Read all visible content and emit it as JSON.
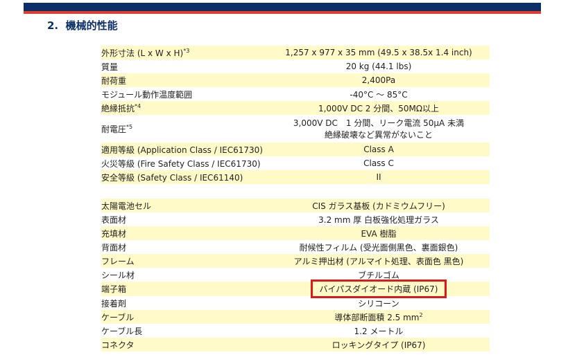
{
  "section": {
    "number": "2.",
    "title": "機械的性能"
  },
  "table1": [
    {
      "label": "外形寸法 (L x W x H)",
      "sup": "*3",
      "value": "1,257 x 977 x 35 mm (49.5 x 38.5x 1.4 inch)"
    },
    {
      "label": "質量",
      "value": "20 kg (44.1 lbs)"
    },
    {
      "label": "耐荷重",
      "value": "2,400Pa"
    },
    {
      "label": "モジュール動作温度範囲",
      "value": "-40°C ～ 85°C"
    },
    {
      "label": "絶縁抵抗",
      "sup": "*4",
      "value": "1,000V DC 2 分間、50MΩ以上"
    },
    {
      "label": "耐電圧",
      "sup": "*5",
      "value": "3,000V DC　1 分間、リーク電流 50μA 未満",
      "value2": "絶縁破壊など異常がないこと"
    },
    {
      "label": "適用等級 (Application Class / IEC61730)",
      "value": "Class A"
    },
    {
      "label": "火災等級 (Fire Safety Class / IEC61730)",
      "value": "Class C"
    },
    {
      "label": "安全等級 (Safety Class / IEC61140)",
      "value": "II"
    }
  ],
  "table2": [
    {
      "label": "太陽電池セル",
      "value": "CIS ガラス基板 (カドミウムフリー)"
    },
    {
      "label": "表面材",
      "value": "3.2 mm 厚 白板強化処理ガラス"
    },
    {
      "label": "充填材",
      "value": "EVA 樹脂"
    },
    {
      "label": "背面材",
      "value": "耐候性フィルム (受光面側黒色、裏面銀色)"
    },
    {
      "label": "フレーム",
      "value": "アルミ押出材 (アルマイト処理、表面色 黒色)"
    },
    {
      "label": "シール材",
      "value": "ブチルゴム"
    },
    {
      "label": "端子箱",
      "value": "バイパスダイオード内蔵 (IP67)"
    },
    {
      "label": "接着剤",
      "value": "シリコーン"
    },
    {
      "label": "ケーブル",
      "value": "導体部断面積 2.5 mm",
      "sup": "2"
    },
    {
      "label": "ケーブル長",
      "value": "1.2 メートル"
    },
    {
      "label": "コネクタ",
      "value": "ロッキングタイプ (IP67)"
    }
  ]
}
